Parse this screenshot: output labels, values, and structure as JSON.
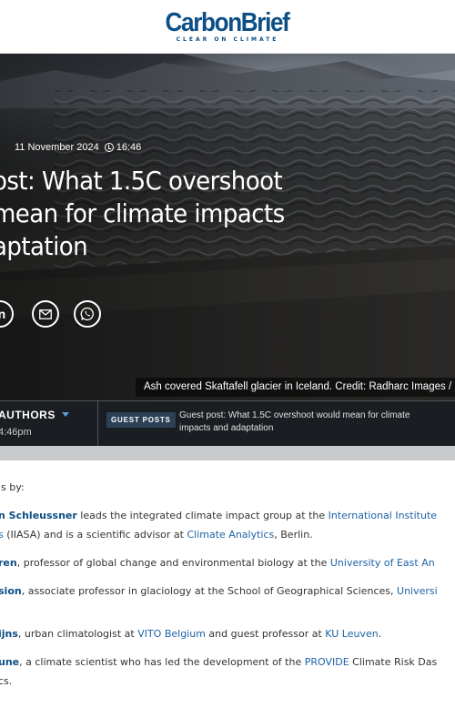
{
  "site": {
    "brand": "CarbonBrief",
    "tagline": "CLEAR ON CLIMATE"
  },
  "article": {
    "date": "11 November 2024",
    "time": "16:46",
    "title_lines": [
      "ost: What 1.5C overshoot",
      "mean for climate impacts",
      "aptation"
    ],
    "caption": "Ash covered Skaftafell glacier in Iceland. Credit: Radharc Images /"
  },
  "share": {
    "linkedin": "in",
    "email": "✉",
    "whatsapp": "✆"
  },
  "authors_bar": {
    "authors_label": "AUTHORS",
    "time": "4:46pm",
    "badge": "GUEST POSTS",
    "related_title": "Guest post: What 1.5C overshoot would mean for climate impacts and adaptation"
  },
  "body": {
    "intro": "is by:",
    "authors": [
      {
        "name": "n Schleussner",
        "line1_text": " leads the integrated climate impact group at the ",
        "line1_link": "International Institute",
        "line2_link": "s",
        "line2_text": " (IIASA) and is a scientific advisor at ",
        "line2_link2": "Climate Analytics",
        "line2_end": ", Berlin."
      },
      {
        "name": "ren",
        "text": ", professor of global change and environmental biology at the ",
        "link": "University of East An"
      },
      {
        "name": "sion",
        "text": ", associate professor in glaciology at the School of Geographical Sciences, ",
        "link": "Universi"
      },
      {
        "name": "ijns",
        "text": ", urban climatologist at ",
        "link": "VITO Belgium",
        "text2": " and guest professor at ",
        "link2": "KU Leuven",
        "end": "."
      },
      {
        "name": "une",
        "text": ", a climate scientist who has led the development of the ",
        "link": "PROVIDE",
        "text2": " Climate Risk Das",
        "line2": "cs."
      }
    ]
  }
}
